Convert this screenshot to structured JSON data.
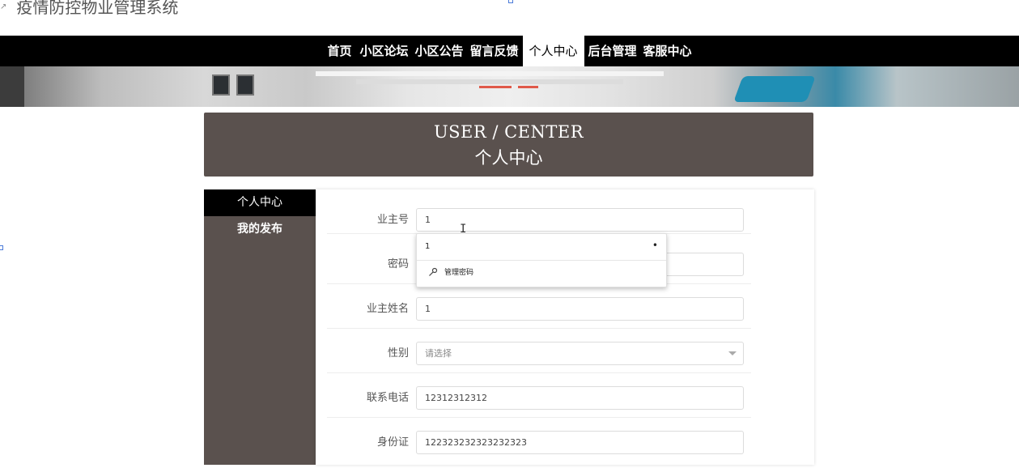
{
  "site_title": "疫情防控物业管理系统",
  "nav": {
    "items": [
      "首页",
      "小区论坛",
      "小区公告",
      "留言反馈",
      "个人中心",
      "后台管理",
      "客服中心"
    ],
    "active_index": 4
  },
  "header": {
    "en": "USER / CENTER",
    "cn": "个人中心"
  },
  "sidebar": {
    "items": [
      "个人中心",
      "我的发布"
    ],
    "active_index": 0
  },
  "form": {
    "rows": [
      {
        "label": "业主号",
        "value": "1",
        "type": "text"
      },
      {
        "label": "密码",
        "value": "",
        "type": "password"
      },
      {
        "label": "业主姓名",
        "value": "1",
        "type": "text"
      },
      {
        "label": "性别",
        "value": "请选择",
        "type": "select"
      },
      {
        "label": "联系电话",
        "value": "12312312312",
        "type": "text"
      },
      {
        "label": "身份证",
        "value": "122323232323232323",
        "type": "text"
      }
    ]
  },
  "autofill": {
    "suggestion": "1",
    "dot": "•",
    "manage_label": "管理密码",
    "manage_icon": "key-icon"
  },
  "colors": {
    "brown": "#5a514e",
    "nav_bg": "#000000"
  }
}
